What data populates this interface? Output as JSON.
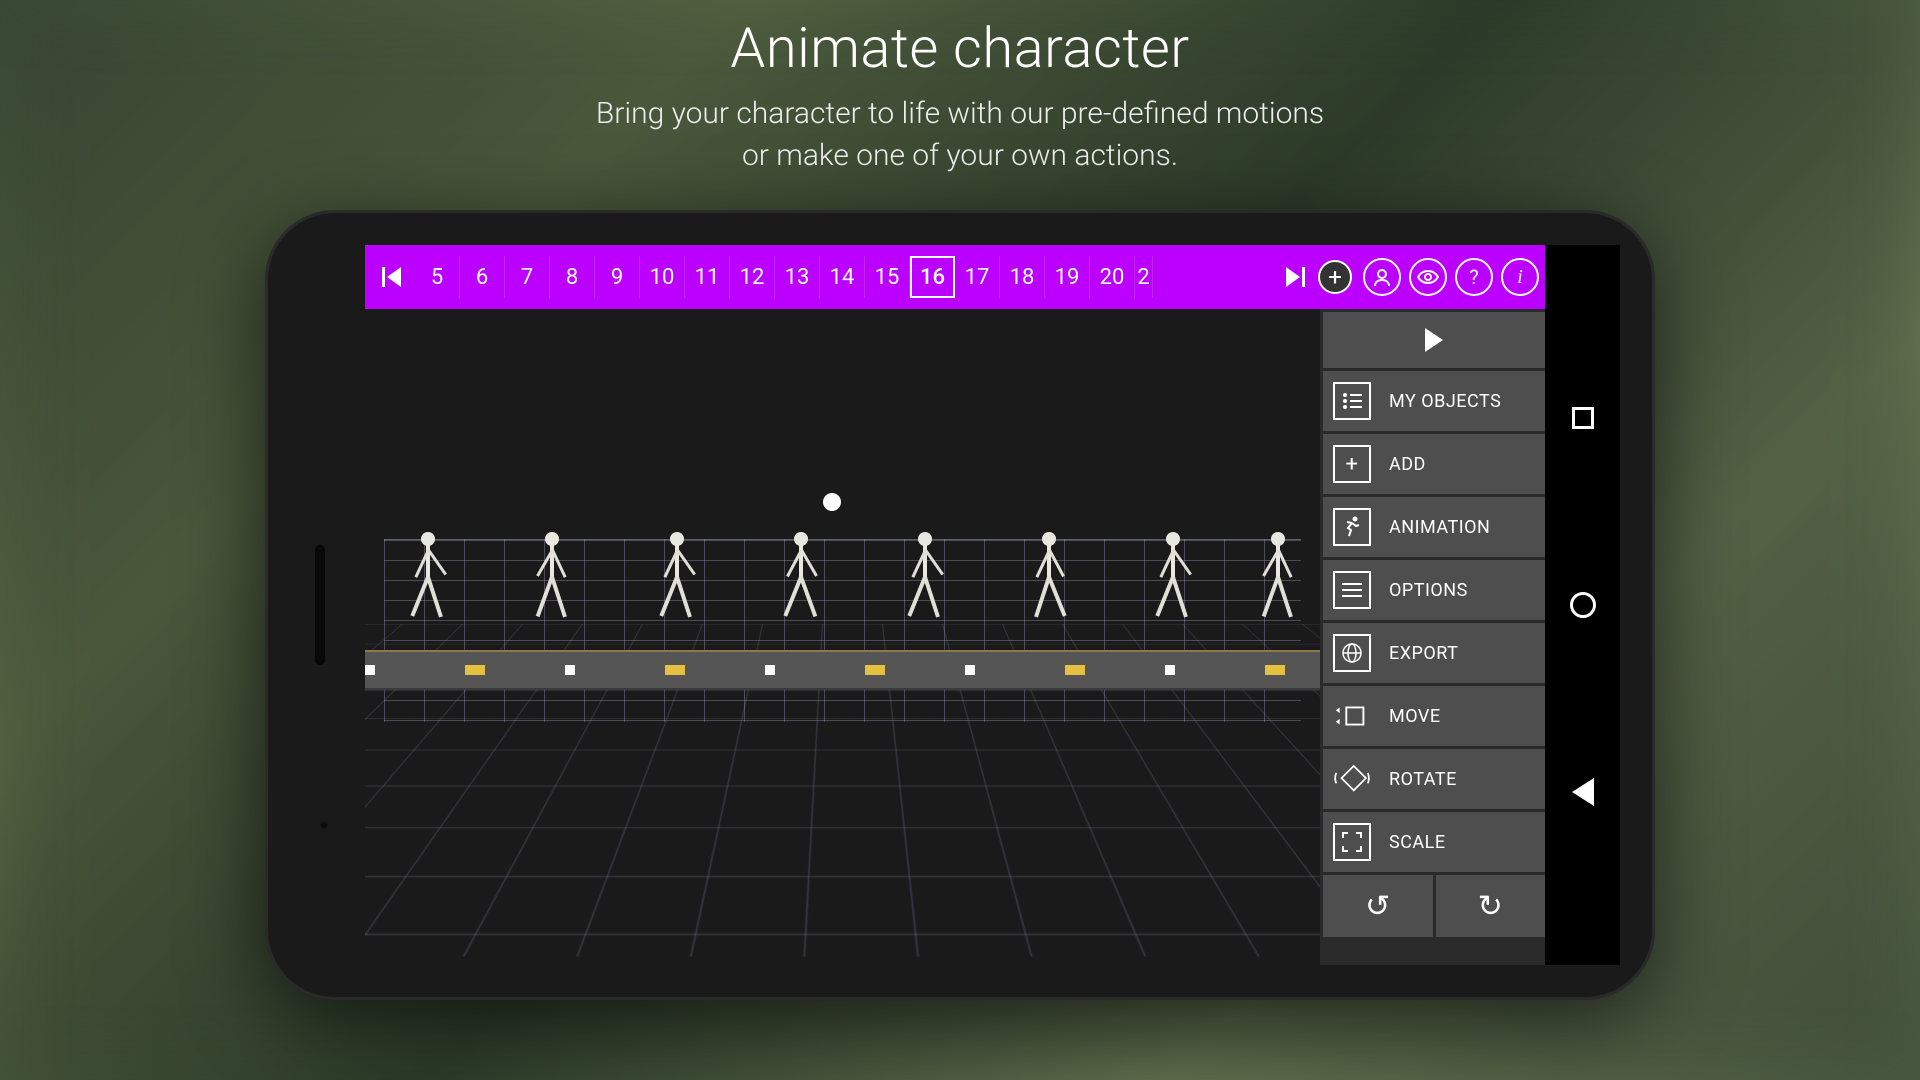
{
  "header": {
    "title": "Animate character",
    "subtitle_line1": "Bring your character to life with our  pre-defined motions",
    "subtitle_line2": "or make one of your own actions."
  },
  "timeline": {
    "frames": [
      "5",
      "6",
      "7",
      "8",
      "9",
      "10",
      "11",
      "12",
      "13",
      "14",
      "15",
      "16",
      "17",
      "18",
      "19",
      "20"
    ],
    "current_frame": "16",
    "partial_frame": "2"
  },
  "toolbar_icons": {
    "skip_start": "skip-to-start",
    "skip_end": "skip-to-end",
    "add_frame": "+",
    "profile": "profile",
    "view": "view",
    "help": "?",
    "info": "i"
  },
  "side_panel": {
    "play": "play",
    "items": [
      {
        "icon": "list",
        "label": "MY OBJECTS"
      },
      {
        "icon": "plus",
        "label": "ADD"
      },
      {
        "icon": "runner",
        "label": "ANIMATION"
      },
      {
        "icon": "options",
        "label": "OPTIONS"
      },
      {
        "icon": "globe",
        "label": "EXPORT"
      },
      {
        "icon": "move",
        "label": "MOVE"
      },
      {
        "icon": "rotate",
        "label": "ROTATE"
      },
      {
        "icon": "scale",
        "label": "SCALE"
      }
    ],
    "undo": "undo",
    "redo": "redo"
  },
  "colors": {
    "accent": "#bc00ff",
    "panel": "#4e4e4e"
  }
}
